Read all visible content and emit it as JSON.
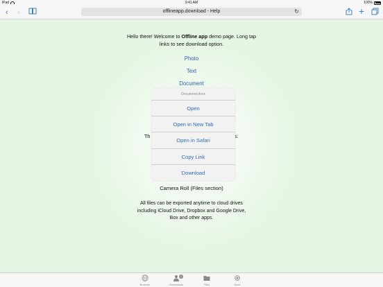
{
  "status_bar": {
    "device": "iPad",
    "time": "9:41 AM",
    "battery": "100%"
  },
  "toolbar": {
    "url": "offlineapp.download - Help",
    "icons": [
      "back-icon",
      "forward-icon",
      "bookmarks-icon",
      "reload-icon",
      "share-icon",
      "add-icon",
      "tabs-icon"
    ]
  },
  "page": {
    "intro_pre": "Hello there! Welcome to ",
    "intro_bold": "Offline app",
    "intro_post": " demo page. Long tap links to see download option.",
    "links": [
      "Photo",
      "Text",
      "Document"
    ],
    "partial_left": "Th",
    "partial_right": "s:",
    "camera_roll": "Camera Roll (Files section)",
    "export_text": "All files can be exported anytime to cloud drives including iCloud Drive, Dropbox and Google Drive, Box and other apps."
  },
  "context_menu": {
    "title": "Document.docx",
    "items": [
      "Open",
      "Open in New Tab",
      "Open in Safari",
      "Copy Link",
      "Download"
    ]
  },
  "tab_bar": {
    "tabs": [
      {
        "label": "Browser",
        "icon": "globe-icon"
      },
      {
        "label": "Downloads",
        "icon": "downloads-icon",
        "badge": "1"
      },
      {
        "label": "Files",
        "icon": "folder-icon"
      },
      {
        "label": "More",
        "icon": "gear-icon"
      }
    ]
  }
}
